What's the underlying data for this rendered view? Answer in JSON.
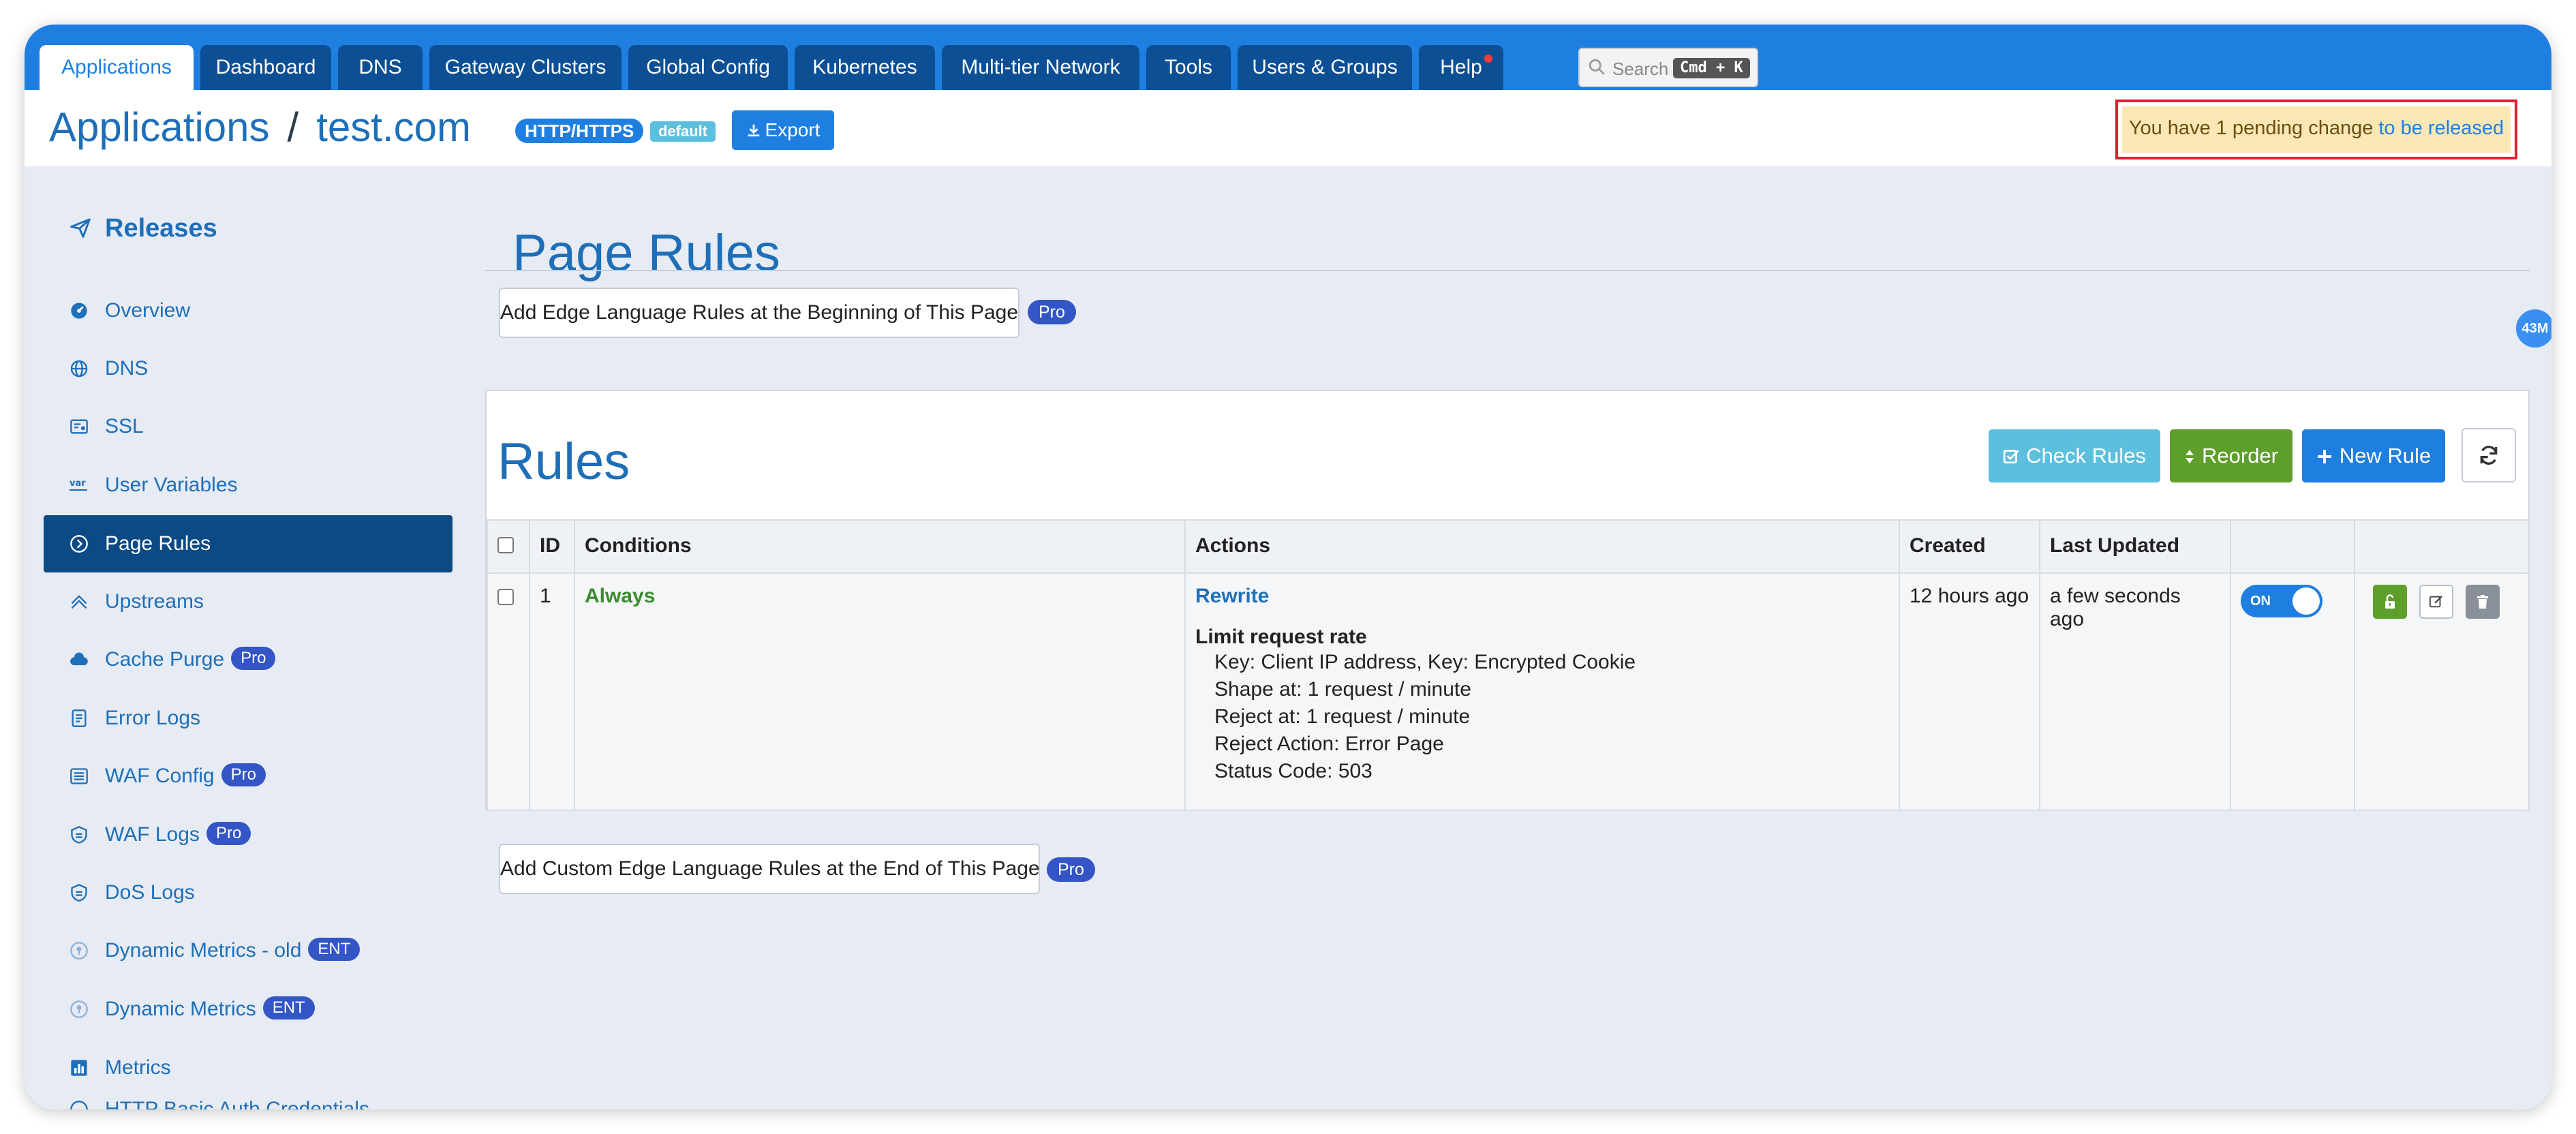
{
  "nav": {
    "tabs": [
      {
        "label": "Applications",
        "active": true
      },
      {
        "label": "Dashboard"
      },
      {
        "label": "DNS"
      },
      {
        "label": "Gateway Clusters"
      },
      {
        "label": "Global Config"
      },
      {
        "label": "Kubernetes"
      },
      {
        "label": "Multi-tier Network"
      },
      {
        "label": "Tools"
      },
      {
        "label": "Users & Groups"
      },
      {
        "label": "Help",
        "notification": true
      }
    ],
    "search": {
      "placeholder": "Search",
      "shortcut": "Cmd + K",
      "icon": "search-icon"
    }
  },
  "header": {
    "breadcrumb_root": "Applications",
    "separator": "/",
    "app_name": "test.com",
    "protocol_badge": "HTTP/HTTPS",
    "partition_badge": "default",
    "export_label": "Export",
    "pending_text": "You have 1 pending change",
    "pending_link": "to be released"
  },
  "sidebar": {
    "heading": "Releases",
    "items": [
      {
        "label": "Overview",
        "icon": "dashboard-icon"
      },
      {
        "label": "DNS",
        "icon": "dns-icon"
      },
      {
        "label": "SSL",
        "icon": "certificate-icon"
      },
      {
        "label": "User Variables",
        "icon": "var-icon"
      },
      {
        "label": "Page Rules",
        "icon": "rules-icon",
        "active": true
      },
      {
        "label": "Upstreams",
        "icon": "upstream-icon"
      },
      {
        "label": "Cache Purge",
        "icon": "cloud-icon",
        "badge": "Pro"
      },
      {
        "label": "Error Logs",
        "icon": "log-icon"
      },
      {
        "label": "WAF Config",
        "icon": "list-icon",
        "badge": "Pro"
      },
      {
        "label": "WAF Logs",
        "icon": "shield-icon",
        "badge": "Pro"
      },
      {
        "label": "DoS Logs",
        "icon": "shield-icon"
      },
      {
        "label": "Dynamic Metrics - old",
        "icon": "location-icon",
        "badge": "ENT"
      },
      {
        "label": "Dynamic Metrics",
        "icon": "location-icon",
        "badge": "ENT"
      },
      {
        "label": "Metrics",
        "icon": "bar-chart-icon"
      },
      {
        "label": "HTTP Basic Auth Credentials",
        "icon": "key-icon"
      }
    ]
  },
  "main": {
    "title": "Page Rules",
    "add_top_label": "Add Edge Language Rules at the Beginning of This Page",
    "add_top_badge": "Pro",
    "add_bottom_label": "Add Custom Edge Language Rules at the End of This Page",
    "add_bottom_badge": "Pro",
    "mem_badge": "43M"
  },
  "rules": {
    "title": "Rules",
    "check_label": "Check Rules",
    "reorder_label": "Reorder",
    "new_label": "New Rule",
    "columns": [
      "ID",
      "Conditions",
      "Actions",
      "Created",
      "Last Updated"
    ],
    "rows": [
      {
        "id": "1",
        "condition": "Always",
        "action_title": "Rewrite",
        "action_sub": "Limit request rate",
        "details": [
          "Key: Client IP address, Key: Encrypted Cookie",
          "Shape at: 1 request / minute",
          "Reject at: 1 request / minute",
          "Reject Action: Error Page",
          "Status Code: 503"
        ],
        "created": "12 hours ago",
        "updated": "a few seconds ago",
        "toggle": "ON"
      }
    ]
  },
  "colors": {
    "nav_blue": "#1f7fe0",
    "tab_dark": "#0c4f94",
    "active_side": "#0c4a85",
    "check_btn": "#5bc0de",
    "reorder_btn": "#5e9e2a",
    "pending_bg": "#fbe7b5",
    "pending_border": "#e0202e"
  }
}
